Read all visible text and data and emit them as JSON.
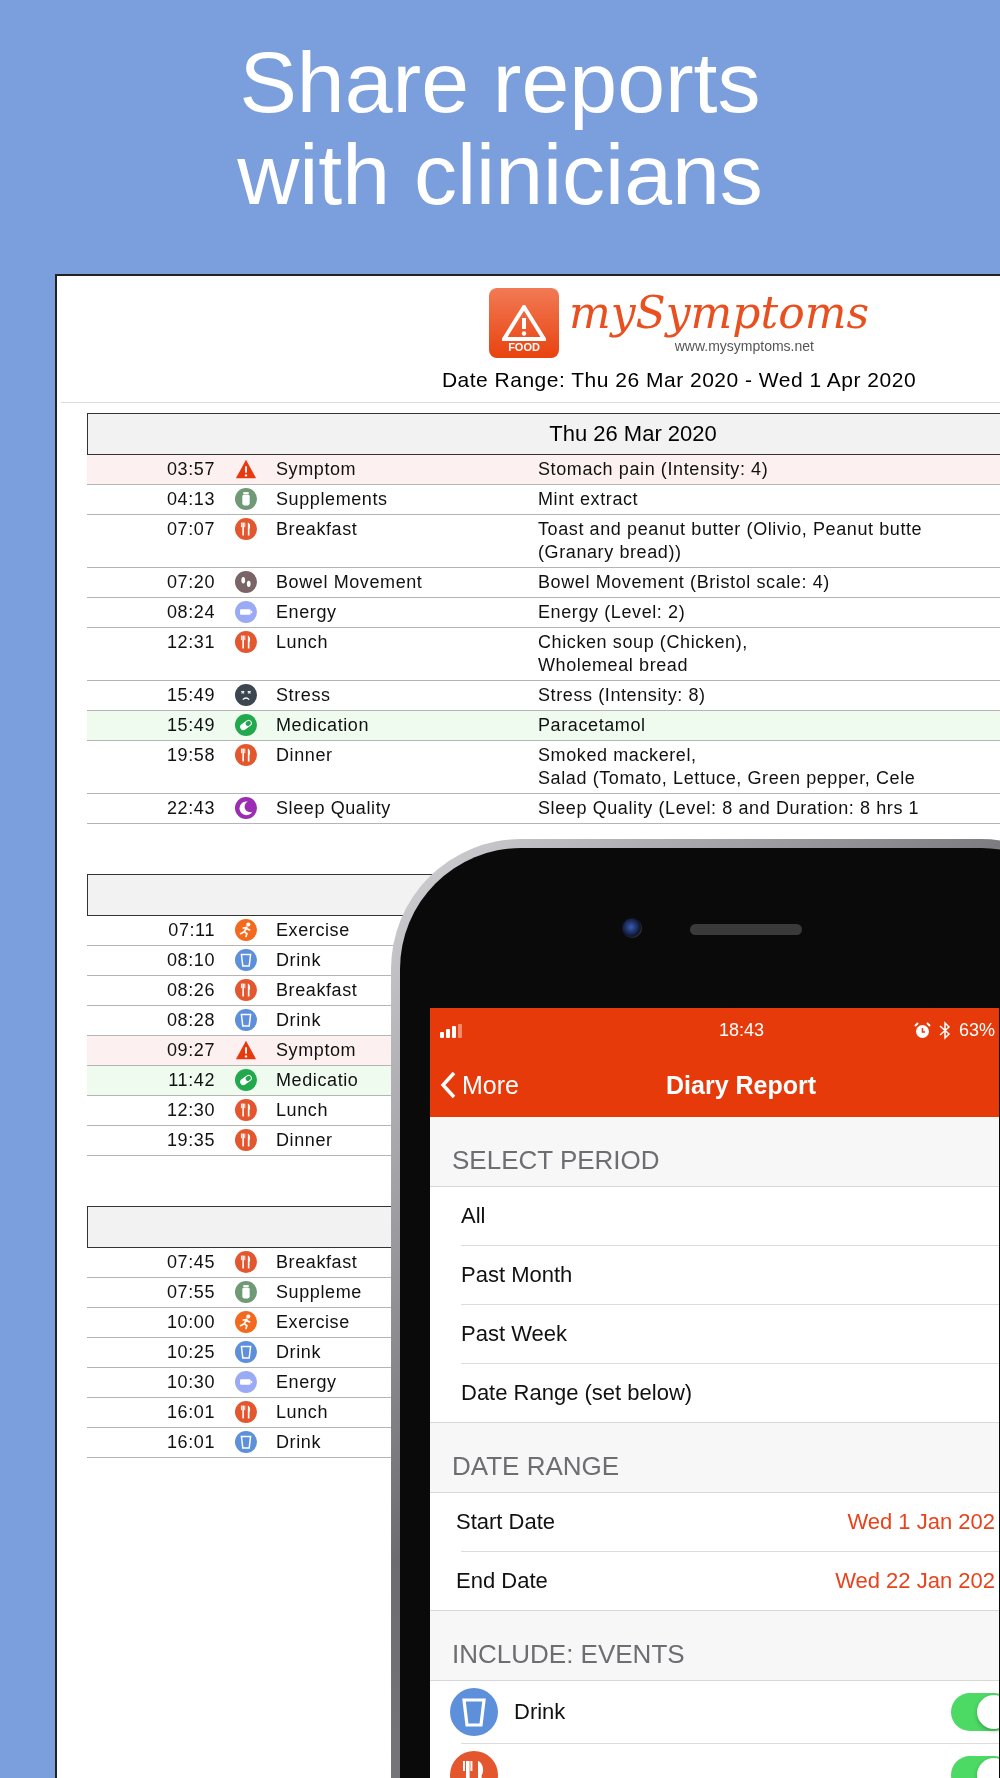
{
  "headline": "Share reports\nwith clinicians",
  "report": {
    "logo": {
      "badge": "FOOD",
      "name": "mySymptoms",
      "url": "www.mysymptoms.net"
    },
    "date_range": "Date Range: Thu 26 Mar 2020 - Wed 1 Apr 2020",
    "days": [
      {
        "date": "Thu 26 Mar 2020",
        "rows": [
          {
            "time": "03:57",
            "kind": "symptom",
            "category": "Symptom",
            "detail": "Stomach pain  (Intensity: 4)"
          },
          {
            "time": "04:13",
            "kind": "supplement",
            "category": "Supplements",
            "detail": "Mint extract"
          },
          {
            "time": "07:07",
            "kind": "meal",
            "category": "Breakfast",
            "detail": "Toast and peanut butter (Olivio, Peanut butte\n(Granary bread))"
          },
          {
            "time": "07:20",
            "kind": "bowel",
            "category": "Bowel Movement",
            "detail": "Bowel Movement  (Bristol scale: 4)"
          },
          {
            "time": "08:24",
            "kind": "energy",
            "category": "Energy",
            "detail": "Energy  (Level: 2)"
          },
          {
            "time": "12:31",
            "kind": "meal",
            "category": "Lunch",
            "detail": "Chicken soup (Chicken),\nWholemeal bread"
          },
          {
            "time": "15:49",
            "kind": "stress",
            "category": "Stress",
            "detail": "Stress  (Intensity: 8)"
          },
          {
            "time": "15:49",
            "kind": "medication",
            "category": "Medication",
            "detail": "Paracetamol"
          },
          {
            "time": "19:58",
            "kind": "meal",
            "category": "Dinner",
            "detail": "Smoked mackerel,\nSalad (Tomato, Lettuce, Green pepper, Cele"
          },
          {
            "time": "22:43",
            "kind": "sleep",
            "category": "Sleep Quality",
            "detail": "Sleep Quality  (Level: 8 and Duration: 8 hrs 1"
          }
        ]
      },
      {
        "rows": [
          {
            "time": "07:11",
            "kind": "exercise",
            "category": "Exercise"
          },
          {
            "time": "08:10",
            "kind": "drink",
            "category": "Drink"
          },
          {
            "time": "08:26",
            "kind": "meal",
            "category": "Breakfast"
          },
          {
            "time": "08:28",
            "kind": "drink",
            "category": "Drink"
          },
          {
            "time": "09:27",
            "kind": "symptom",
            "category": "Symptom"
          },
          {
            "time": "11:42",
            "kind": "medication",
            "category": "Medicatio"
          },
          {
            "time": "12:30",
            "kind": "meal",
            "category": "Lunch"
          },
          {
            "time": "19:35",
            "kind": "meal",
            "category": "Dinner"
          }
        ]
      },
      {
        "rows": [
          {
            "time": "07:45",
            "kind": "meal",
            "category": "Breakfast"
          },
          {
            "time": "07:55",
            "kind": "supplement",
            "category": "Suppleme"
          },
          {
            "time": "10:00",
            "kind": "exercise",
            "category": "Exercise"
          },
          {
            "time": "10:25",
            "kind": "drink",
            "category": "Drink"
          },
          {
            "time": "10:30",
            "kind": "energy",
            "category": "Energy"
          },
          {
            "time": "16:01",
            "kind": "meal",
            "category": "Lunch"
          },
          {
            "time": "16:01",
            "kind": "drink",
            "category": "Drink"
          }
        ]
      }
    ]
  },
  "phone": {
    "status": {
      "time": "18:43",
      "battery": "63%"
    },
    "nav": {
      "back": "More",
      "title": "Diary Report"
    },
    "sections": [
      {
        "header": "SELECT PERIOD",
        "rows": [
          {
            "label": "All"
          },
          {
            "label": "Past Month"
          },
          {
            "label": "Past Week"
          },
          {
            "label": "Date Range (set below)"
          }
        ]
      },
      {
        "header": "DATE RANGE",
        "rows": [
          {
            "label": "Start Date",
            "value": "Wed 1 Jan 202"
          },
          {
            "label": "End Date",
            "value": "Wed 22 Jan 202"
          }
        ]
      },
      {
        "header": "INCLUDE: EVENTS",
        "rows": [
          {
            "kind": "drink",
            "label": "Drink",
            "on": true
          },
          {
            "kind": "meal",
            "on": true
          }
        ]
      }
    ]
  }
}
